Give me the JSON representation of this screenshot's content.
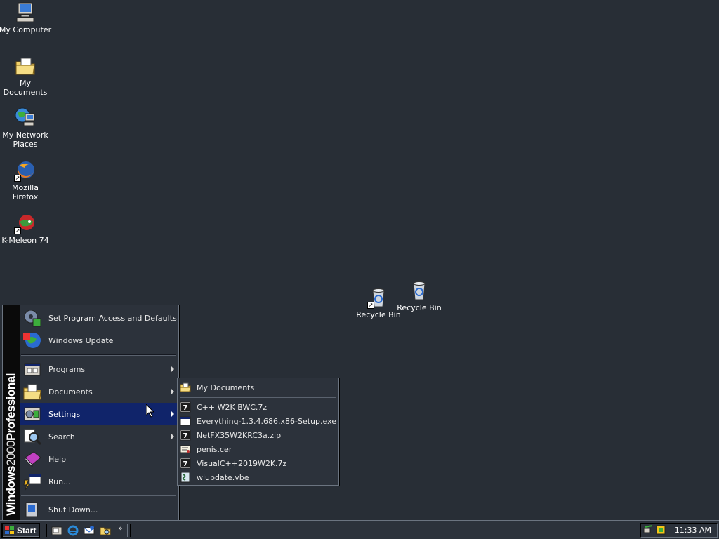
{
  "desktop": {
    "icons": [
      {
        "label": "My Computer"
      },
      {
        "label": "My Documents"
      },
      {
        "label": "My Network\nPlaces"
      },
      {
        "label": "Mozilla Firefox"
      },
      {
        "label": "K-Meleon 74"
      },
      {
        "label": "Recycle Bin"
      },
      {
        "label": "Recycle Bin"
      }
    ]
  },
  "start_menu": {
    "brand_bold": "Windows",
    "brand_light": "2000",
    "brand_tail": "Professional",
    "items": [
      {
        "label": "Set Program Access and Defaults",
        "icon": "program-access-icon"
      },
      {
        "label": "Windows Update",
        "icon": "windows-update-icon"
      },
      {
        "label": "Programs",
        "icon": "programs-icon",
        "has_submenu": true
      },
      {
        "label": "Documents",
        "icon": "documents-icon",
        "has_submenu": true
      },
      {
        "label": "Settings",
        "icon": "settings-icon",
        "has_submenu": true,
        "highlighted": true
      },
      {
        "label": "Search",
        "icon": "search-icon",
        "has_submenu": true
      },
      {
        "label": "Help",
        "icon": "help-icon"
      },
      {
        "label": "Run...",
        "icon": "run-icon"
      },
      {
        "label": "Shut Down...",
        "icon": "shutdown-icon"
      }
    ]
  },
  "documents_submenu": {
    "items": [
      {
        "label": "My Documents",
        "icon": "folder-icon"
      },
      {
        "label": "C++ W2K BWC.7z",
        "icon": "7z-archive-icon"
      },
      {
        "label": "Everything-1.3.4.686.x86-Setup.exe",
        "icon": "exe-icon"
      },
      {
        "label": "NetFX35W2KRC3a.zip",
        "icon": "zip-archive-icon"
      },
      {
        "label": "penis.cer",
        "icon": "certificate-icon"
      },
      {
        "label": "VisualC++2019W2K.7z",
        "icon": "7z-archive-icon"
      },
      {
        "label": "wlupdate.vbe",
        "icon": "script-icon"
      }
    ]
  },
  "taskbar": {
    "start_label": "Start",
    "quick_launch_more": "»",
    "clock": "11:33 AM"
  },
  "colors": {
    "desktop_bg": "#282e36",
    "menu_bg": "#2c323b",
    "highlight": "#10246a"
  }
}
